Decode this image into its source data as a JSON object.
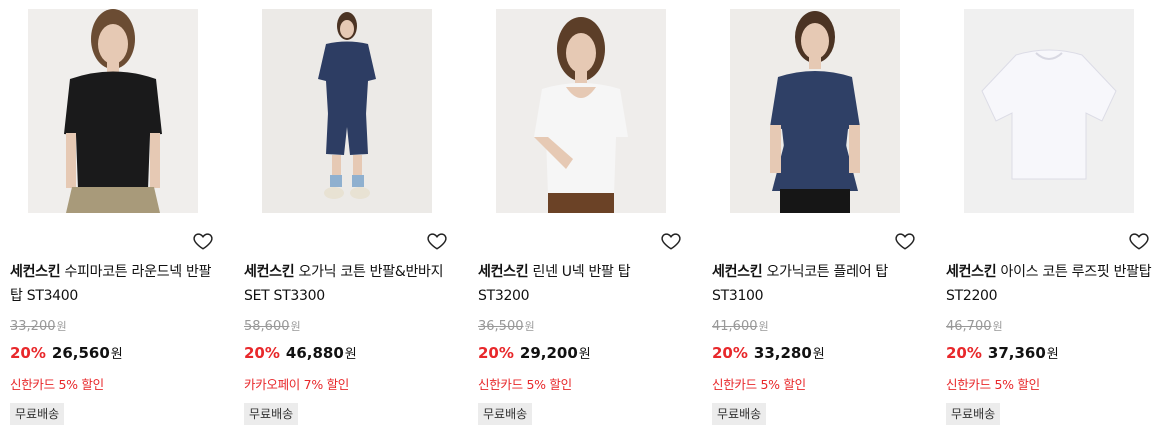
{
  "products": [
    {
      "brand": "세컨스킨",
      "name": "수피마코튼 라운드넥 반팔탑 ST3400",
      "original_price": "33,200",
      "discount_rate": "20%",
      "price": "26,560",
      "currency": "원",
      "promo": "신한카드 5% 할인",
      "badge": "무료배송",
      "image": "woman-black-tshirt",
      "colors": {
        "bg": "#f0eeec",
        "top": "#1a1a1b",
        "bottom": "#a89a7a",
        "skin": "#e6c9b4",
        "hair": "#6b4c33"
      }
    },
    {
      "brand": "세컨스킨",
      "name": "오가닉 코튼 반팔&반바지 SET ST3300",
      "original_price": "58,600",
      "discount_rate": "20%",
      "price": "46,880",
      "currency": "원",
      "promo": "카카오페이 7% 할인",
      "badge": "무료배송",
      "image": "woman-navy-set",
      "colors": {
        "bg": "#eceae7",
        "top": "#2d3d63",
        "bottom": "#2d3d63",
        "skin": "#e6c9b4",
        "hair": "#4b3323"
      }
    },
    {
      "brand": "세컨스킨",
      "name": "린넨 U넥 반팔 탑 ST3200",
      "original_price": "36,500",
      "discount_rate": "20%",
      "price": "29,200",
      "currency": "원",
      "promo": "신한카드 5% 할인",
      "badge": "무료배송",
      "image": "woman-white-tshirt",
      "colors": {
        "bg": "#efedeb",
        "top": "#f6f6f6",
        "bottom": "#6b4226",
        "skin": "#e6c9b4",
        "hair": "#5c3e28"
      }
    },
    {
      "brand": "세컨스킨",
      "name": "오가닉코튼 플레어 탑 ST3100",
      "original_price": "41,600",
      "discount_rate": "20%",
      "price": "33,280",
      "currency": "원",
      "promo": "신한카드 5% 할인",
      "badge": "무료배송",
      "image": "woman-navy-flare-top",
      "colors": {
        "bg": "#eeece9",
        "top": "#2f4066",
        "bottom": "#161616",
        "skin": "#e6c9b4",
        "hair": "#4b3323"
      }
    },
    {
      "brand": "세컨스킨",
      "name": "아이스 코튼 루즈핏 반팔탑 ST2200",
      "original_price": "46,700",
      "discount_rate": "20%",
      "price": "37,360",
      "currency": "원",
      "promo": "신한카드 5% 할인",
      "badge": "무료배송",
      "image": "white-tshirt-flat",
      "colors": {
        "bg": "#f0f0f0",
        "top": "#f7f7fb",
        "bottom": "",
        "skin": "",
        "hair": ""
      }
    }
  ],
  "wishlist_icon": "heart-outline-icon"
}
